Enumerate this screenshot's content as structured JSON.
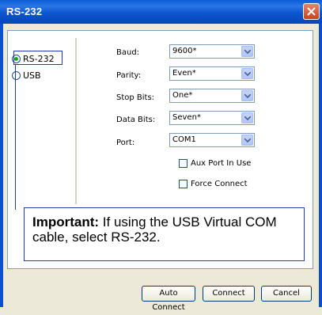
{
  "window": {
    "title": "RS-232"
  },
  "connection_type": {
    "options": [
      {
        "label": "RS-232",
        "selected": true
      },
      {
        "label": "USB",
        "selected": false
      }
    ]
  },
  "fields": {
    "baud": {
      "label": "Baud:",
      "value": "9600*"
    },
    "parity": {
      "label": "Parity:",
      "value": "Even*"
    },
    "stop_bits": {
      "label": "Stop Bits:",
      "value": "One*"
    },
    "data_bits": {
      "label": "Data Bits:",
      "value": "Seven*"
    },
    "port": {
      "label": "Port:",
      "value": "COM1"
    }
  },
  "checkboxes": {
    "aux_port": {
      "label": "Aux Port In Use",
      "checked": false
    },
    "force_connect": {
      "label": "Force Connect",
      "checked": false
    }
  },
  "note": {
    "bold": "Important:",
    "text": " If using the USB Virtual COM cable, select RS-232."
  },
  "buttons": {
    "auto_connect": "Auto Connect",
    "connect": "Connect",
    "cancel": "Cancel"
  },
  "colors": {
    "title_bar": "#0a5fd8",
    "accent": "#1f3ab8",
    "close": "#c7431d"
  }
}
